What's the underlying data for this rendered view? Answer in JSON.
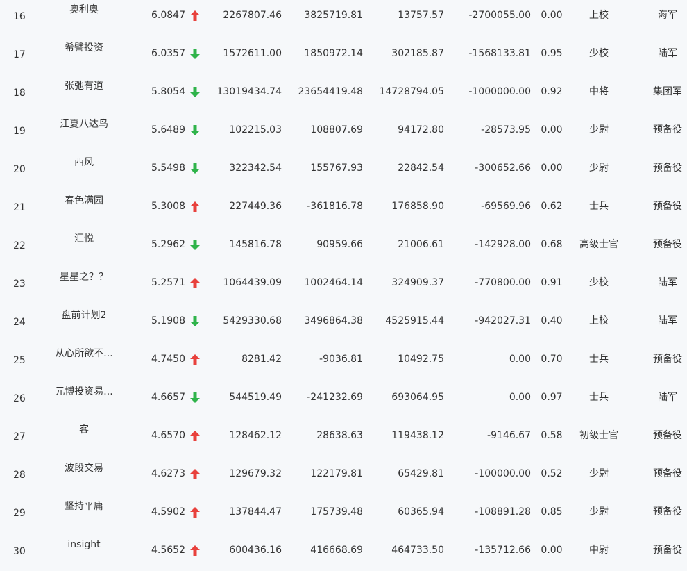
{
  "colors": {
    "background": "#f6f8fa",
    "text": "#333333",
    "trend_up": "#e8413c",
    "trend_down": "#2fb34a"
  },
  "rows": [
    {
      "rank": "16",
      "name": "奥利奥",
      "score": "6.0847",
      "trend": "up",
      "v1": "2267807.46",
      "v2": "3825719.81",
      "v3": "13757.57",
      "v4": "-2700055.00",
      "ratio": "0.00",
      "military_rank": "上校",
      "branch": "海军"
    },
    {
      "rank": "17",
      "name": "希譬投资",
      "score": "6.0357",
      "trend": "down",
      "v1": "1572611.00",
      "v2": "1850972.14",
      "v3": "302185.87",
      "v4": "-1568133.81",
      "ratio": "0.95",
      "military_rank": "少校",
      "branch": "陆军"
    },
    {
      "rank": "18",
      "name": "张弛有道",
      "score": "5.8054",
      "trend": "down",
      "v1": "13019434.74",
      "v2": "23654419.48",
      "v3": "14728794.05",
      "v4": "-1000000.00",
      "ratio": "0.92",
      "military_rank": "中将",
      "branch": "集团军"
    },
    {
      "rank": "19",
      "name": "江夏八达鸟",
      "score": "5.6489",
      "trend": "down",
      "v1": "102215.03",
      "v2": "108807.69",
      "v3": "94172.80",
      "v4": "-28573.95",
      "ratio": "0.00",
      "military_rank": "少尉",
      "branch": "预备役"
    },
    {
      "rank": "20",
      "name": "西风",
      "score": "5.5498",
      "trend": "down",
      "v1": "322342.54",
      "v2": "155767.93",
      "v3": "22842.54",
      "v4": "-300652.66",
      "ratio": "0.00",
      "military_rank": "少尉",
      "branch": "预备役"
    },
    {
      "rank": "21",
      "name": "春色满园",
      "score": "5.3008",
      "trend": "up",
      "v1": "227449.36",
      "v2": "-361816.78",
      "v3": "176858.90",
      "v4": "-69569.96",
      "ratio": "0.62",
      "military_rank": "士兵",
      "branch": "预备役"
    },
    {
      "rank": "22",
      "name": "汇悦",
      "score": "5.2962",
      "trend": "down",
      "v1": "145816.78",
      "v2": "90959.66",
      "v3": "21006.61",
      "v4": "-142928.00",
      "ratio": "0.68",
      "military_rank": "高级士官",
      "branch": "预备役"
    },
    {
      "rank": "23",
      "name": "星星之？？",
      "score": "5.2571",
      "trend": "up",
      "v1": "1064439.09",
      "v2": "1002464.14",
      "v3": "324909.37",
      "v4": "-770800.00",
      "ratio": "0.91",
      "military_rank": "少校",
      "branch": "陆军"
    },
    {
      "rank": "24",
      "name": "盘前计划2",
      "score": "5.1908",
      "trend": "down",
      "v1": "5429330.68",
      "v2": "3496864.38",
      "v3": "4525915.44",
      "v4": "-942027.31",
      "ratio": "0.40",
      "military_rank": "上校",
      "branch": "陆军"
    },
    {
      "rank": "25",
      "name": "从心所欲不...",
      "score": "4.7450",
      "trend": "up",
      "v1": "8281.42",
      "v2": "-9036.81",
      "v3": "10492.75",
      "v4": "0.00",
      "ratio": "0.70",
      "military_rank": "士兵",
      "branch": "预备役"
    },
    {
      "rank": "26",
      "name": "元博投资易...",
      "score": "4.6657",
      "trend": "down",
      "v1": "544519.49",
      "v2": "-241232.69",
      "v3": "693064.95",
      "v4": "0.00",
      "ratio": "0.97",
      "military_rank": "士兵",
      "branch": "陆军"
    },
    {
      "rank": "27",
      "name": "客",
      "score": "4.6570",
      "trend": "up",
      "v1": "128462.12",
      "v2": "28638.63",
      "v3": "119438.12",
      "v4": "-9146.67",
      "ratio": "0.58",
      "military_rank": "初级士官",
      "branch": "预备役"
    },
    {
      "rank": "28",
      "name": "波段交易",
      "score": "4.6273",
      "trend": "up",
      "v1": "129679.32",
      "v2": "122179.81",
      "v3": "65429.81",
      "v4": "-100000.00",
      "ratio": "0.52",
      "military_rank": "少尉",
      "branch": "预备役"
    },
    {
      "rank": "29",
      "name": "坚持平庸",
      "score": "4.5902",
      "trend": "up",
      "v1": "137844.47",
      "v2": "175739.48",
      "v3": "60365.94",
      "v4": "-108891.28",
      "ratio": "0.85",
      "military_rank": "少尉",
      "branch": "预备役"
    },
    {
      "rank": "30",
      "name": "insight",
      "score": "4.5652",
      "trend": "up",
      "v1": "600436.16",
      "v2": "416668.69",
      "v3": "464733.50",
      "v4": "-135712.66",
      "ratio": "0.00",
      "military_rank": "中尉",
      "branch": "预备役"
    }
  ]
}
